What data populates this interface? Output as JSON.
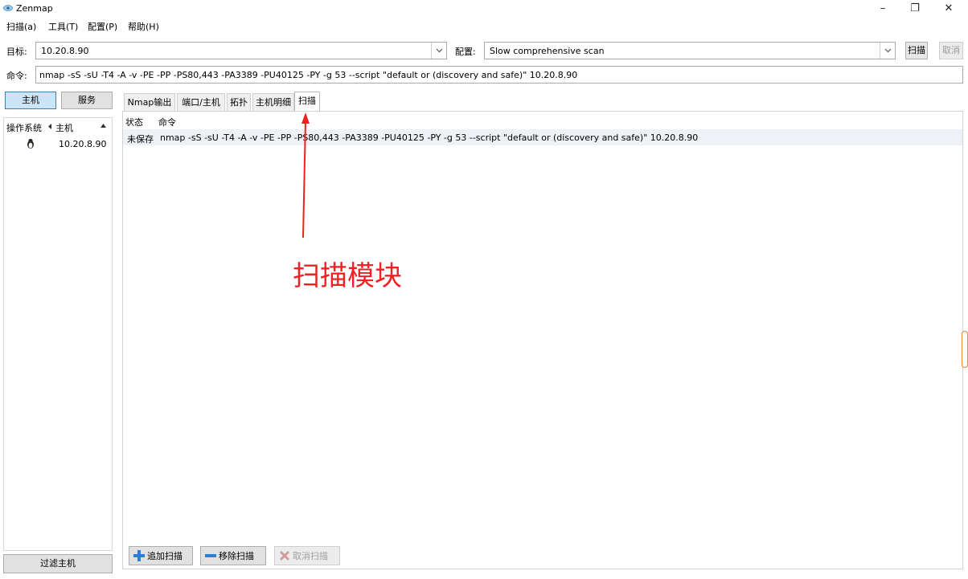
{
  "window": {
    "title": "Zenmap",
    "minimize": "–",
    "restore": "❐",
    "close": "✕"
  },
  "menu": [
    "扫描(a)",
    "工具(T)",
    "配置(P)",
    "帮助(H)"
  ],
  "target": {
    "label": "目标:",
    "value": "10.20.8.90"
  },
  "profile": {
    "label": "配置:",
    "value": "Slow comprehensive scan"
  },
  "buttons": {
    "scan": "扫描",
    "cancel": "取消"
  },
  "command": {
    "label": "命令:",
    "value": "nmap -sS -sU -T4 -A -v -PE -PP -PS80,443 -PA3389 -PU40125 -PY -g 53 --script \"default or (discovery and safe)\" 10.20.8.90"
  },
  "left": {
    "hosts_tab": "主机",
    "services_tab": "服务",
    "col_os": "操作系统",
    "col_host": "主机",
    "hosts": [
      {
        "os_icon": "linux-penguin-icon",
        "host": "10.20.8.90"
      }
    ],
    "filter": "过滤主机"
  },
  "tabs": [
    "Nmap输出",
    "端口/主机",
    "拓扑",
    "主机明细",
    "扫描"
  ],
  "active_tab": 4,
  "scans": {
    "col_status": "状态",
    "col_command": "命令",
    "rows": [
      {
        "status": "未保存",
        "command": "nmap -sS -sU -T4 -A -v -PE -PP -PS80,443 -PA3389 -PU40125 -PY -g 53 --script \"default or (discovery and safe)\" 10.20.8.90"
      }
    ],
    "add": "追加扫描",
    "remove": "移除扫描",
    "cancel": "取消扫描"
  },
  "annotation": {
    "text": "扫描模块",
    "color": "#ee2222"
  },
  "colors": {
    "accent": "#3c7fb1",
    "active_tab_bg": "#cce4f7",
    "add_icon": "#2a7fd4",
    "remove_icon": "#2a7fd4"
  }
}
